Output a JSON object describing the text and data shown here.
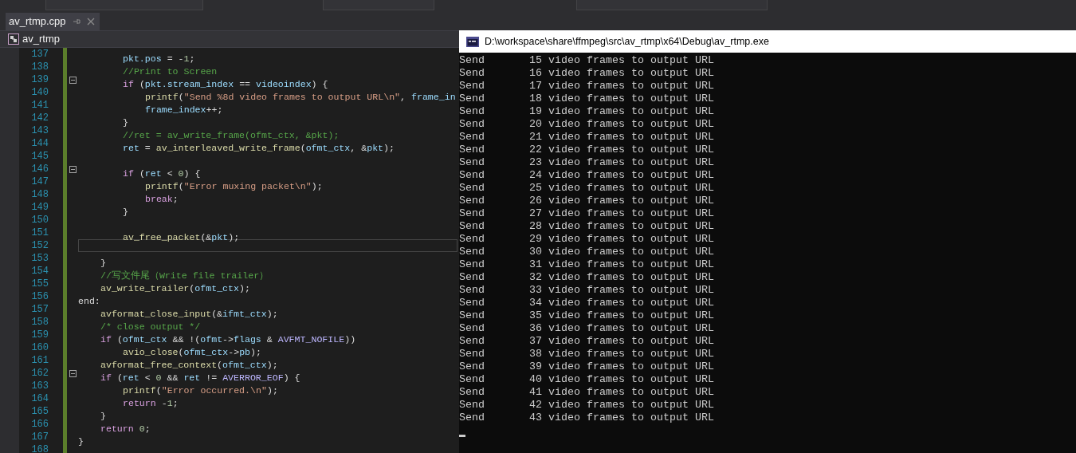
{
  "document_tab": {
    "label": "av_rtmp.cpp"
  },
  "navigation_bar": {
    "scope": "av_rtmp"
  },
  "editor": {
    "lines": [
      {
        "number": "137",
        "fold_marker": false,
        "current": false,
        "tokens": [
          {
            "kind": "var",
            "text": "\t\tpkt.pos"
          },
          {
            "kind": "plain",
            "text": " = -"
          },
          {
            "kind": "number",
            "text": "1"
          },
          {
            "kind": "plain",
            "text": ";"
          }
        ]
      },
      {
        "number": "138",
        "fold_marker": false,
        "current": false,
        "tokens": [
          {
            "kind": "comment",
            "text": "\t\t//Print to Screen"
          }
        ]
      },
      {
        "number": "139",
        "fold_marker": true,
        "current": false,
        "tokens": [
          {
            "kind": "keyword",
            "text": "\t\tif"
          },
          {
            "kind": "plain",
            "text": " ("
          },
          {
            "kind": "var",
            "text": "pkt.stream_index"
          },
          {
            "kind": "plain",
            "text": " == "
          },
          {
            "kind": "var",
            "text": "videoindex"
          },
          {
            "kind": "plain",
            "text": ") {"
          }
        ]
      },
      {
        "number": "140",
        "fold_marker": false,
        "current": false,
        "tokens": [
          {
            "kind": "function",
            "text": "\t\t\tprintf"
          },
          {
            "kind": "plain",
            "text": "("
          },
          {
            "kind": "string",
            "text": "\"Send %8d video frames to output URL\\n\""
          },
          {
            "kind": "plain",
            "text": ", "
          },
          {
            "kind": "var",
            "text": "frame_in"
          }
        ]
      },
      {
        "number": "141",
        "fold_marker": false,
        "current": false,
        "tokens": [
          {
            "kind": "var",
            "text": "\t\t\tframe_index"
          },
          {
            "kind": "plain",
            "text": "++;"
          }
        ]
      },
      {
        "number": "142",
        "fold_marker": false,
        "current": false,
        "tokens": [
          {
            "kind": "plain",
            "text": "\t\t}"
          }
        ]
      },
      {
        "number": "143",
        "fold_marker": false,
        "current": false,
        "tokens": [
          {
            "kind": "comment",
            "text": "\t\t//ret = av_write_frame(ofmt_ctx, &pkt);"
          }
        ]
      },
      {
        "number": "144",
        "fold_marker": false,
        "current": false,
        "tokens": [
          {
            "kind": "var",
            "text": "\t\tret"
          },
          {
            "kind": "plain",
            "text": " = "
          },
          {
            "kind": "function",
            "text": "av_interleaved_write_frame"
          },
          {
            "kind": "plain",
            "text": "("
          },
          {
            "kind": "var",
            "text": "ofmt_ctx"
          },
          {
            "kind": "plain",
            "text": ", &"
          },
          {
            "kind": "var",
            "text": "pkt"
          },
          {
            "kind": "plain",
            "text": ");"
          }
        ]
      },
      {
        "number": "145",
        "fold_marker": false,
        "current": false
      },
      {
        "number": "146",
        "fold_marker": true,
        "current": false,
        "tokens": [
          {
            "kind": "keyword",
            "text": "\t\tif"
          },
          {
            "kind": "plain",
            "text": " ("
          },
          {
            "kind": "var",
            "text": "ret"
          },
          {
            "kind": "plain",
            "text": " < "
          },
          {
            "kind": "number",
            "text": "0"
          },
          {
            "kind": "plain",
            "text": ") {"
          }
        ]
      },
      {
        "number": "147",
        "fold_marker": false,
        "current": false,
        "tokens": [
          {
            "kind": "function",
            "text": "\t\t\tprintf"
          },
          {
            "kind": "plain",
            "text": "("
          },
          {
            "kind": "string",
            "text": "\"Error muxing packet\\n\""
          },
          {
            "kind": "plain",
            "text": ");"
          }
        ]
      },
      {
        "number": "148",
        "fold_marker": false,
        "current": false,
        "tokens": [
          {
            "kind": "keyword",
            "text": "\t\t\tbreak"
          },
          {
            "kind": "plain",
            "text": ";"
          }
        ]
      },
      {
        "number": "149",
        "fold_marker": false,
        "current": false,
        "tokens": [
          {
            "kind": "plain",
            "text": "\t\t}"
          }
        ]
      },
      {
        "number": "150",
        "fold_marker": false,
        "current": false
      },
      {
        "number": "151",
        "fold_marker": false,
        "current": false,
        "tokens": [
          {
            "kind": "function",
            "text": "\t\tav_free_packet"
          },
          {
            "kind": "plain",
            "text": "(&"
          },
          {
            "kind": "var",
            "text": "pkt"
          },
          {
            "kind": "plain",
            "text": ");"
          }
        ]
      },
      {
        "number": "152",
        "fold_marker": false,
        "current": true
      },
      {
        "number": "153",
        "fold_marker": false,
        "current": false,
        "tokens": [
          {
            "kind": "plain",
            "text": "\t}"
          }
        ]
      },
      {
        "number": "154",
        "fold_marker": false,
        "current": false,
        "tokens": [
          {
            "kind": "comment",
            "text": "\t//写文件尾（Write file trailer）"
          }
        ]
      },
      {
        "number": "155",
        "fold_marker": false,
        "current": false,
        "tokens": [
          {
            "kind": "function",
            "text": "\tav_write_trailer"
          },
          {
            "kind": "plain",
            "text": "("
          },
          {
            "kind": "var",
            "text": "ofmt_ctx"
          },
          {
            "kind": "plain",
            "text": ");"
          }
        ]
      },
      {
        "number": "156",
        "fold_marker": false,
        "current": false,
        "tokens": [
          {
            "kind": "plain",
            "text": "end:"
          }
        ]
      },
      {
        "number": "157",
        "fold_marker": false,
        "current": false,
        "tokens": [
          {
            "kind": "function",
            "text": "\tavformat_close_input"
          },
          {
            "kind": "plain",
            "text": "(&"
          },
          {
            "kind": "var",
            "text": "ifmt_ctx"
          },
          {
            "kind": "plain",
            "text": ");"
          }
        ]
      },
      {
        "number": "158",
        "fold_marker": false,
        "current": false,
        "tokens": [
          {
            "kind": "comment",
            "text": "\t/* close output */"
          }
        ]
      },
      {
        "number": "159",
        "fold_marker": false,
        "current": false,
        "tokens": [
          {
            "kind": "keyword",
            "text": "\tif"
          },
          {
            "kind": "plain",
            "text": " ("
          },
          {
            "kind": "var",
            "text": "ofmt_ctx"
          },
          {
            "kind": "plain",
            "text": " && !("
          },
          {
            "kind": "var",
            "text": "ofmt"
          },
          {
            "kind": "plain",
            "text": "->"
          },
          {
            "kind": "var",
            "text": "flags"
          },
          {
            "kind": "plain",
            "text": " & "
          },
          {
            "kind": "macro",
            "text": "AVFMT_NOFILE"
          },
          {
            "kind": "plain",
            "text": "))"
          }
        ]
      },
      {
        "number": "160",
        "fold_marker": false,
        "current": false,
        "tokens": [
          {
            "kind": "function",
            "text": "\t\tavio_close"
          },
          {
            "kind": "plain",
            "text": "("
          },
          {
            "kind": "var",
            "text": "ofmt_ctx"
          },
          {
            "kind": "plain",
            "text": "->"
          },
          {
            "kind": "var",
            "text": "pb"
          },
          {
            "kind": "plain",
            "text": ");"
          }
        ]
      },
      {
        "number": "161",
        "fold_marker": false,
        "current": false,
        "tokens": [
          {
            "kind": "function",
            "text": "\tavformat_free_context"
          },
          {
            "kind": "plain",
            "text": "("
          },
          {
            "kind": "var",
            "text": "ofmt_ctx"
          },
          {
            "kind": "plain",
            "text": ");"
          }
        ]
      },
      {
        "number": "162",
        "fold_marker": true,
        "current": false,
        "tokens": [
          {
            "kind": "keyword",
            "text": "\tif"
          },
          {
            "kind": "plain",
            "text": " ("
          },
          {
            "kind": "var",
            "text": "ret"
          },
          {
            "kind": "plain",
            "text": " < "
          },
          {
            "kind": "number",
            "text": "0"
          },
          {
            "kind": "plain",
            "text": " && "
          },
          {
            "kind": "var",
            "text": "ret"
          },
          {
            "kind": "plain",
            "text": " != "
          },
          {
            "kind": "macro",
            "text": "AVERROR_EOF"
          },
          {
            "kind": "plain",
            "text": ") {"
          }
        ]
      },
      {
        "number": "163",
        "fold_marker": false,
        "current": false,
        "tokens": [
          {
            "kind": "function",
            "text": "\t\tprintf"
          },
          {
            "kind": "plain",
            "text": "("
          },
          {
            "kind": "string",
            "text": "\"Error occurred.\\n\""
          },
          {
            "kind": "plain",
            "text": ");"
          }
        ]
      },
      {
        "number": "164",
        "fold_marker": false,
        "current": false,
        "tokens": [
          {
            "kind": "keyword",
            "text": "\t\treturn"
          },
          {
            "kind": "plain",
            "text": " -"
          },
          {
            "kind": "number",
            "text": "1"
          },
          {
            "kind": "plain",
            "text": ";"
          }
        ]
      },
      {
        "number": "165",
        "fold_marker": false,
        "current": false,
        "tokens": [
          {
            "kind": "plain",
            "text": "\t}"
          }
        ]
      },
      {
        "number": "166",
        "fold_marker": false,
        "current": false,
        "tokens": [
          {
            "kind": "keyword",
            "text": "\treturn"
          },
          {
            "kind": "number",
            "text": " 0"
          },
          {
            "kind": "plain",
            "text": ";"
          }
        ]
      },
      {
        "number": "167",
        "fold_marker": false,
        "current": false,
        "tokens": [
          {
            "kind": "plain",
            "text": "}"
          }
        ]
      },
      {
        "number": "168",
        "fold_marker": false,
        "current": false
      }
    ]
  },
  "console": {
    "title": "D:\\workspace\\share\\ffmpeg\\src\\av_rtmp\\x64\\Debug\\av_rtmp.exe",
    "lines": [
      "Send       15 video frames to output URL",
      "Send       16 video frames to output URL",
      "Send       17 video frames to output URL",
      "Send       18 video frames to output URL",
      "Send       19 video frames to output URL",
      "Send       20 video frames to output URL",
      "Send       21 video frames to output URL",
      "Send       22 video frames to output URL",
      "Send       23 video frames to output URL",
      "Send       24 video frames to output URL",
      "Send       25 video frames to output URL",
      "Send       26 video frames to output URL",
      "Send       27 video frames to output URL",
      "Send       28 video frames to output URL",
      "Send       29 video frames to output URL",
      "Send       30 video frames to output URL",
      "Send       31 video frames to output URL",
      "Send       32 video frames to output URL",
      "Send       33 video frames to output URL",
      "Send       34 video frames to output URL",
      "Send       35 video frames to output URL",
      "Send       36 video frames to output URL",
      "Send       37 video frames to output URL",
      "Send       38 video frames to output URL",
      "Send       39 video frames to output URL",
      "Send       40 video frames to output URL",
      "Send       41 video frames to output URL",
      "Send       42 video frames to output URL",
      "Send       43 video frames to output URL"
    ]
  }
}
